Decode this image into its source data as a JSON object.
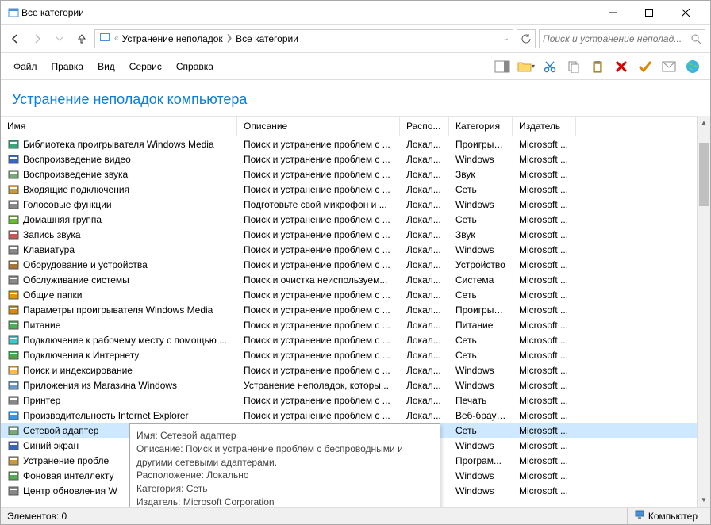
{
  "window": {
    "title": "Все категории"
  },
  "breadcrumb": {
    "parts": [
      "Устранение неполадок",
      "Все категории"
    ]
  },
  "search": {
    "placeholder": "Поиск и устранение неполад..."
  },
  "menu": {
    "file": "Файл",
    "edit": "Правка",
    "view": "Вид",
    "service": "Сервис",
    "help": "Справка"
  },
  "heading": "Устранение неполадок компьютера",
  "columns": {
    "name": "Имя",
    "desc": "Описание",
    "loc": "Распо...",
    "cat": "Категория",
    "pub": "Издатель"
  },
  "rows": [
    {
      "name": "Библиотека проигрывателя Windows Media",
      "desc": "Поиск и устранение проблем с ...",
      "loc": "Локал...",
      "cat": "Проигрыв...",
      "pub": "Microsoft ...",
      "icon": "#3a7"
    },
    {
      "name": "Воспроизведение видео",
      "desc": "Поиск и устранение проблем с ...",
      "loc": "Локал...",
      "cat": "Windows",
      "pub": "Microsoft ...",
      "icon": "#36c"
    },
    {
      "name": "Воспроизведение звука",
      "desc": "Поиск и устранение проблем с ...",
      "loc": "Локал...",
      "cat": "Звук",
      "pub": "Microsoft ...",
      "icon": "#7a7"
    },
    {
      "name": "Входящие подключения",
      "desc": "Поиск и устранение проблем с ...",
      "loc": "Локал...",
      "cat": "Сеть",
      "pub": "Microsoft ...",
      "icon": "#c93"
    },
    {
      "name": "Голосовые функции",
      "desc": "Подготовьте свой микрофон и ...",
      "loc": "Локал...",
      "cat": "Windows",
      "pub": "Microsoft ...",
      "icon": "#888"
    },
    {
      "name": "Домашняя группа",
      "desc": "Поиск и устранение проблем с ...",
      "loc": "Локал...",
      "cat": "Сеть",
      "pub": "Microsoft ...",
      "icon": "#6b3"
    },
    {
      "name": "Запись звука",
      "desc": "Поиск и устранение проблем с ...",
      "loc": "Локал...",
      "cat": "Звук",
      "pub": "Microsoft ...",
      "icon": "#c55"
    },
    {
      "name": "Клавиатура",
      "desc": "Поиск и устранение проблем с ...",
      "loc": "Локал...",
      "cat": "Windows",
      "pub": "Microsoft ...",
      "icon": "#888"
    },
    {
      "name": "Оборудование и устройства",
      "desc": "Поиск и устранение проблем с ...",
      "loc": "Локал...",
      "cat": "Устройство",
      "pub": "Microsoft ...",
      "icon": "#a73"
    },
    {
      "name": "Обслуживание системы",
      "desc": "Поиск и очистка неиспользуем...",
      "loc": "Локал...",
      "cat": "Система",
      "pub": "Microsoft ...",
      "icon": "#888"
    },
    {
      "name": "Общие папки",
      "desc": "Поиск и устранение проблем с ...",
      "loc": "Локал...",
      "cat": "Сеть",
      "pub": "Microsoft ...",
      "icon": "#d90"
    },
    {
      "name": "Параметры проигрывателя Windows Media",
      "desc": "Поиск и устранение проблем с ...",
      "loc": "Локал...",
      "cat": "Проигрыв...",
      "pub": "Microsoft ...",
      "icon": "#d80"
    },
    {
      "name": "Питание",
      "desc": "Поиск и устранение проблем с ...",
      "loc": "Локал...",
      "cat": "Питание",
      "pub": "Microsoft ...",
      "icon": "#5a5"
    },
    {
      "name": "Подключение к рабочему месту с помощью ...",
      "desc": "Поиск и устранение проблем с ...",
      "loc": "Локал...",
      "cat": "Сеть",
      "pub": "Microsoft ...",
      "icon": "#3cc"
    },
    {
      "name": "Подключения к Интернету",
      "desc": "Поиск и устранение проблем с ...",
      "loc": "Локал...",
      "cat": "Сеть",
      "pub": "Microsoft ...",
      "icon": "#4a4"
    },
    {
      "name": "Поиск и индексирование",
      "desc": "Поиск и устранение проблем с ...",
      "loc": "Локал...",
      "cat": "Windows",
      "pub": "Microsoft ...",
      "icon": "#fb4"
    },
    {
      "name": "Приложения из Магазина Windows",
      "desc": "Устранение неполадок, которы...",
      "loc": "Локал...",
      "cat": "Windows",
      "pub": "Microsoft ...",
      "icon": "#69c"
    },
    {
      "name": "Принтер",
      "desc": "Поиск и устранение проблем с ...",
      "loc": "Локал...",
      "cat": "Печать",
      "pub": "Microsoft ...",
      "icon": "#888"
    },
    {
      "name": "Производительность Internet Explorer",
      "desc": "Поиск и устранение проблем с ...",
      "loc": "Локал...",
      "cat": "Веб-брауз...",
      "pub": "Microsoft ...",
      "icon": "#39e"
    },
    {
      "name": "Сетевой адаптер",
      "desc": "Поиск и устранение проблем с ...",
      "loc": "Локал...",
      "cat": "Сеть",
      "pub": "Microsoft ...",
      "icon": "#7a7",
      "selected": true
    },
    {
      "name": "Синий экран",
      "desc": "",
      "loc": "",
      "cat": "Windows",
      "pub": "Microsoft ...",
      "icon": "#36c"
    },
    {
      "name": "Устранение пробле",
      "desc": "",
      "loc": "",
      "cat": "Програм...",
      "pub": "Microsoft ...",
      "icon": "#c93"
    },
    {
      "name": "Фоновая интеллекту",
      "desc": "",
      "loc": "",
      "cat": "Windows",
      "pub": "Microsoft ...",
      "icon": "#5a5"
    },
    {
      "name": "Центр обновления W",
      "desc": "",
      "loc": "",
      "cat": "Windows",
      "pub": "Microsoft ...",
      "icon": "#888"
    }
  ],
  "tooltip": {
    "l1": "Имя: Сетевой адаптер",
    "l2": "Описание: Поиск и устранение проблем с беспроводными и другими сетевыми адаптерами.",
    "l3": "Расположение: Локально",
    "l4": "Категория: Сеть",
    "l5": "Издатель: Microsoft Corporation"
  },
  "statusbar": {
    "elements": "Элементов: 0",
    "computer": "Компьютер"
  }
}
